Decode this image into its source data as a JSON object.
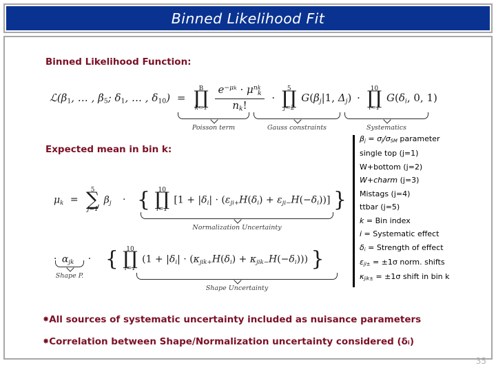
{
  "slide": {
    "title": "Binned Likelihood Fit",
    "page_number": "35",
    "title_bg_color": "#0a3391",
    "title_text_color": "#ffffff",
    "accent_color": "#7b1025",
    "frame_border_color": "#a6a6a6"
  },
  "headings": {
    "function": "Binned Likelihood Function:",
    "expected_mean": "Expected mean in bin k:"
  },
  "equation_likelihood": {
    "lhs": "ℒ(β₁, … , β₅; δ₁, … , δ₁₀) =",
    "lhs_script": "ℒ",
    "lhs_args": "(β",
    "prod1": {
      "top": "B",
      "symbol": "∏",
      "bottom": "k=1"
    },
    "prod2": {
      "top": "5",
      "symbol": "∏",
      "bottom": "j=2"
    },
    "prod3": {
      "top": "10",
      "symbol": "∏",
      "bottom": "i=1"
    },
    "poisson_numerator": "e",
    "poisson_denominator": "n",
    "gauss_term": "G(β",
    "syst_term": "G(δ",
    "brace_labels": {
      "poisson": "Poisson term",
      "gauss": "Gauss constraints",
      "systematics": "Systematics"
    }
  },
  "equation_mean": {
    "mu": "μ",
    "sum": {
      "top": "5",
      "symbol": "∑",
      "bottom": "j=1"
    },
    "prod_norm": {
      "top": "10",
      "symbol": "∏",
      "bottom": "i=1"
    },
    "prod_shape": {
      "top": "10",
      "symbol": "∏",
      "bottom": "i=1"
    },
    "brace_labels": {
      "normalization": "Normalization Uncertainty",
      "shape_p": "Shape P.",
      "shape": "Shape Uncertainty"
    }
  },
  "legend": {
    "items": [
      {
        "text": "βⱼ = σⱼ/σₛₘ parameter"
      },
      {
        "text": "single top (j=1)"
      },
      {
        "text": "W+bottom (j=2)"
      },
      {
        "text": "W+charm (j=3)"
      },
      {
        "text": "Mistags (j=4)"
      },
      {
        "text": "ttbar (j=5)"
      },
      {
        "text": "k = Bin index"
      },
      {
        "text": "i = Systematic effect"
      },
      {
        "text": "δᵢ = Strength of effect"
      },
      {
        "text": "εⱼᵢ± = ±1σ norm. shifts"
      },
      {
        "text": "κⱼᵢₖ± = ±1σ shift in bin k"
      }
    ]
  },
  "bullets": {
    "bullet_glyph": "✸",
    "items": [
      "All sources of systematic uncertainty included as nuisance parameters",
      "Correlation between Shape/Normalization uncertainty considered (δᵢ)"
    ]
  }
}
